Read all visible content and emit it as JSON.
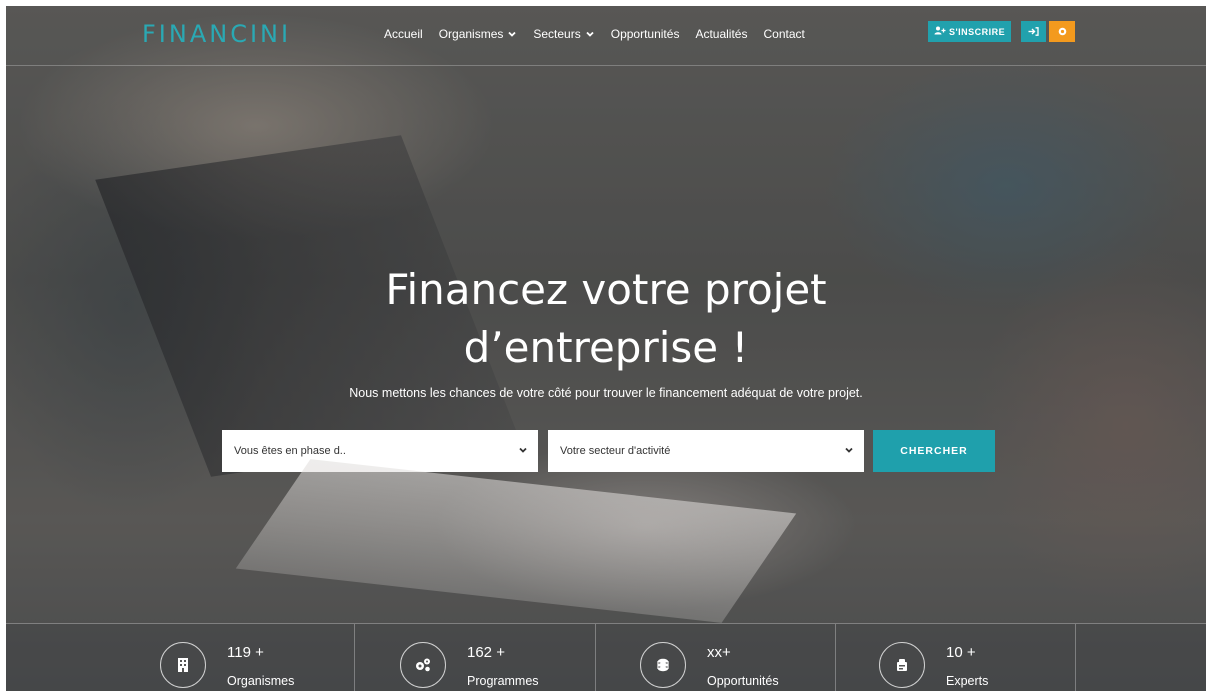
{
  "header": {
    "logo": "FINANCINI",
    "nav": [
      {
        "label": "Accueil",
        "dropdown": false
      },
      {
        "label": "Organismes",
        "dropdown": true
      },
      {
        "label": "Secteurs",
        "dropdown": true
      },
      {
        "label": "Opportunités",
        "dropdown": false
      },
      {
        "label": "Actualités",
        "dropdown": false
      },
      {
        "label": "Contact",
        "dropdown": false
      }
    ],
    "register_label": "S'INSCRIRE",
    "login_icon": "sign-in-icon",
    "language_icon": "globe-icon"
  },
  "hero": {
    "title_line1": "Financez votre projet",
    "title_line2": "d’entreprise !",
    "subtitle": "Nous mettons les chances de votre côté pour trouver le financement adéquat de votre projet."
  },
  "search": {
    "phase_value": "Vous êtes en phase d..",
    "sector_value": "Votre secteur d'activité",
    "button_label": "CHERCHER"
  },
  "stats": [
    {
      "value": "119 +",
      "label": "Organismes",
      "icon": "building-icon"
    },
    {
      "value": "162 +",
      "label": "Programmes",
      "icon": "gears-icon"
    },
    {
      "value": "xx+",
      "label": "Opportunités",
      "icon": "coins-icon"
    },
    {
      "value": "10 +",
      "label": "Experts",
      "icon": "expert-icon"
    }
  ],
  "colors": {
    "accent": "#21a1ad",
    "orange": "#f39a1e",
    "logo": "#2aa9b4"
  }
}
